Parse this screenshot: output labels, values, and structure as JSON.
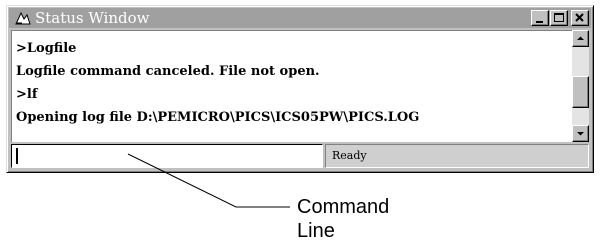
{
  "window": {
    "title": "Status Window",
    "icon": "status-window-icon"
  },
  "output": {
    "lines": [
      ">Logfile",
      "Logfile command canceled. File not open.",
      ">lf",
      "Opening log file D:\\PEMICRO\\PICS\\ICS05PW\\PICS.LOG"
    ]
  },
  "command_line": {
    "value": ""
  },
  "status_bar": {
    "text": "Ready"
  },
  "annotation": {
    "label_line1": "Command",
    "label_line2": "Line"
  },
  "colors": {
    "titlebar": "#a0a0a0",
    "face": "#c0c0c0",
    "text": "#000000"
  }
}
